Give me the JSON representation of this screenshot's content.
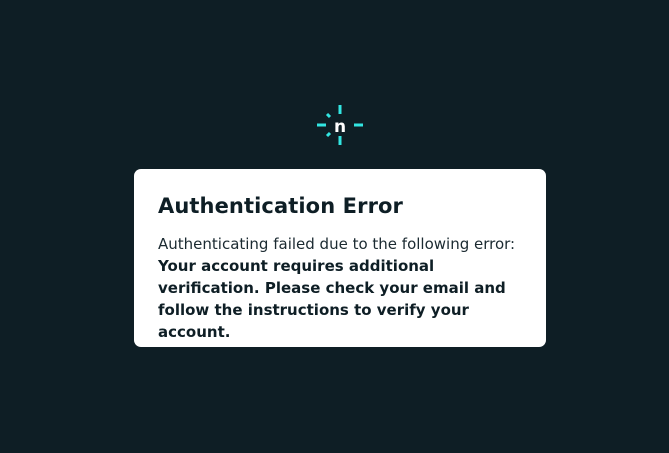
{
  "logo": {
    "icon": "netlify-logo-icon",
    "letter": "n",
    "color": "#32e6e2"
  },
  "error_card": {
    "title": "Authentication Error",
    "intro": "Authenticating failed due to the following error:",
    "message": "Your account requires additional verification. Please check your email and follow the instructions to verify your account."
  },
  "colors": {
    "background": "#0e1e25",
    "card": "#ffffff",
    "accent": "#32e6e2"
  }
}
